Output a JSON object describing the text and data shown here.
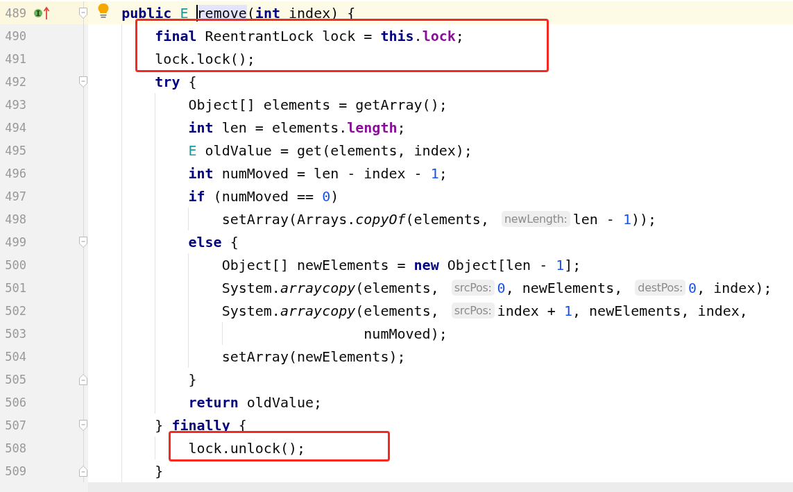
{
  "editor": {
    "lines": [
      {
        "number": "489",
        "current": true,
        "gutter_icons": [
          {
            "kind": "implements"
          }
        ],
        "bulb": true,
        "fold_start": true,
        "tokens": [
          {
            "kind": "keyword",
            "text": "public "
          },
          {
            "kind": "type-param",
            "text": "E "
          },
          {
            "kind": "plain",
            "text": "remove",
            "caret": true,
            "usage": true
          },
          {
            "kind": "plain",
            "text": "("
          },
          {
            "kind": "keyword",
            "text": "int"
          },
          {
            "kind": "plain",
            "text": " index) {"
          }
        ],
        "children": [
          {
            "number": "490",
            "boxed": true,
            "tokens": [
              {
                "kind": "keyword",
                "text": "final"
              },
              {
                "kind": "plain",
                "text": " ReentrantLock lock = "
              },
              {
                "kind": "keyword",
                "text": "this"
              },
              {
                "kind": "plain",
                "text": "."
              },
              {
                "kind": "field",
                "text": "lock"
              },
              {
                "kind": "plain",
                "text": ";"
              }
            ]
          },
          {
            "number": "491",
            "boxed": true,
            "tokens": [
              {
                "kind": "plain",
                "text": "lock.lock();"
              }
            ]
          },
          {
            "number": "492",
            "fold_start": true,
            "tokens": [
              {
                "kind": "keyword",
                "text": "try"
              },
              {
                "kind": "plain",
                "text": " {"
              }
            ],
            "children": [
              {
                "number": "493",
                "tokens": [
                  {
                    "kind": "plain",
                    "text": "Object[] elements = getArray();"
                  }
                ]
              },
              {
                "number": "494",
                "tokens": [
                  {
                    "kind": "keyword",
                    "text": "int"
                  },
                  {
                    "kind": "plain",
                    "text": " len = elements."
                  },
                  {
                    "kind": "field",
                    "text": "length"
                  },
                  {
                    "kind": "plain",
                    "text": ";"
                  }
                ]
              },
              {
                "number": "495",
                "tokens": [
                  {
                    "kind": "type-param",
                    "text": "E"
                  },
                  {
                    "kind": "plain",
                    "text": " oldValue = get(elements, index);"
                  }
                ]
              },
              {
                "number": "496",
                "tokens": [
                  {
                    "kind": "keyword",
                    "text": "int"
                  },
                  {
                    "kind": "plain",
                    "text": " numMoved = len - index - "
                  },
                  {
                    "kind": "number",
                    "text": "1"
                  },
                  {
                    "kind": "plain",
                    "text": ";"
                  }
                ]
              },
              {
                "number": "497",
                "tokens": [
                  {
                    "kind": "keyword",
                    "text": "if"
                  },
                  {
                    "kind": "plain",
                    "text": " (numMoved == "
                  },
                  {
                    "kind": "number",
                    "text": "0"
                  },
                  {
                    "kind": "plain",
                    "text": ")"
                  }
                ],
                "children": [
                  {
                    "number": "498",
                    "tokens": [
                      {
                        "kind": "plain",
                        "text": "setArray(Arrays."
                      },
                      {
                        "kind": "static-call",
                        "text": "copyOf"
                      },
                      {
                        "kind": "plain",
                        "text": "(elements, "
                      },
                      {
                        "kind": "hint",
                        "text": "newLength:"
                      },
                      {
                        "kind": "plain",
                        "text": "len - "
                      },
                      {
                        "kind": "number",
                        "text": "1"
                      },
                      {
                        "kind": "plain",
                        "text": "));"
                      }
                    ]
                  }
                ]
              },
              {
                "number": "499",
                "fold_start": true,
                "tokens": [
                  {
                    "kind": "keyword",
                    "text": "else"
                  },
                  {
                    "kind": "plain",
                    "text": " {"
                  }
                ],
                "children": [
                  {
                    "number": "500",
                    "tokens": [
                      {
                        "kind": "plain",
                        "text": "Object[] newElements = "
                      },
                      {
                        "kind": "keyword",
                        "text": "new"
                      },
                      {
                        "kind": "plain",
                        "text": " Object[len - "
                      },
                      {
                        "kind": "number",
                        "text": "1"
                      },
                      {
                        "kind": "plain",
                        "text": "];"
                      }
                    ]
                  },
                  {
                    "number": "501",
                    "tokens": [
                      {
                        "kind": "plain",
                        "text": "System."
                      },
                      {
                        "kind": "static-call",
                        "text": "arraycopy"
                      },
                      {
                        "kind": "plain",
                        "text": "(elements, "
                      },
                      {
                        "kind": "hint",
                        "text": "srcPos:"
                      },
                      {
                        "kind": "number",
                        "text": "0"
                      },
                      {
                        "kind": "plain",
                        "text": ", newElements, "
                      },
                      {
                        "kind": "hint",
                        "text": "destPos:"
                      },
                      {
                        "kind": "number",
                        "text": "0"
                      },
                      {
                        "kind": "plain",
                        "text": ", index);"
                      }
                    ]
                  },
                  {
                    "number": "502",
                    "tokens": [
                      {
                        "kind": "plain",
                        "text": "System."
                      },
                      {
                        "kind": "static-call",
                        "text": "arraycopy"
                      },
                      {
                        "kind": "plain",
                        "text": "(elements, "
                      },
                      {
                        "kind": "hint",
                        "text": "srcPos:"
                      },
                      {
                        "kind": "plain",
                        "text": "index + "
                      },
                      {
                        "kind": "number",
                        "text": "1"
                      },
                      {
                        "kind": "plain",
                        "text": ", newElements, index,"
                      }
                    ],
                    "children": [
                      {
                        "number": "503",
                        "tokens": [
                          {
                            "kind": "plain",
                            "text": "             numMoved);"
                          }
                        ]
                      }
                    ]
                  },
                  {
                    "number": "504",
                    "tokens": [
                      {
                        "kind": "plain",
                        "text": "setArray(newElements);"
                      }
                    ]
                  }
                ]
              },
              {
                "number": "505",
                "fold_end": true,
                "tokens": [
                  {
                    "kind": "plain",
                    "text": "}"
                  }
                ]
              },
              {
                "number": "506",
                "tokens": [
                  {
                    "kind": "keyword",
                    "text": "return"
                  },
                  {
                    "kind": "plain",
                    "text": " oldValue;"
                  }
                ]
              }
            ]
          },
          {
            "number": "507",
            "fold_start": true,
            "tokens": [
              {
                "kind": "plain",
                "text": "} "
              },
              {
                "kind": "keyword",
                "text": "finally"
              },
              {
                "kind": "plain",
                "text": " {"
              }
            ],
            "children": [
              {
                "number": "508",
                "boxed": true,
                "tokens": [
                  {
                    "kind": "plain",
                    "text": "lock.unlock();"
                  }
                ]
              }
            ]
          },
          {
            "number": "509",
            "fold_end": true,
            "tokens": [
              {
                "kind": "plain",
                "text": "}"
              }
            ]
          }
        ]
      }
    ]
  }
}
